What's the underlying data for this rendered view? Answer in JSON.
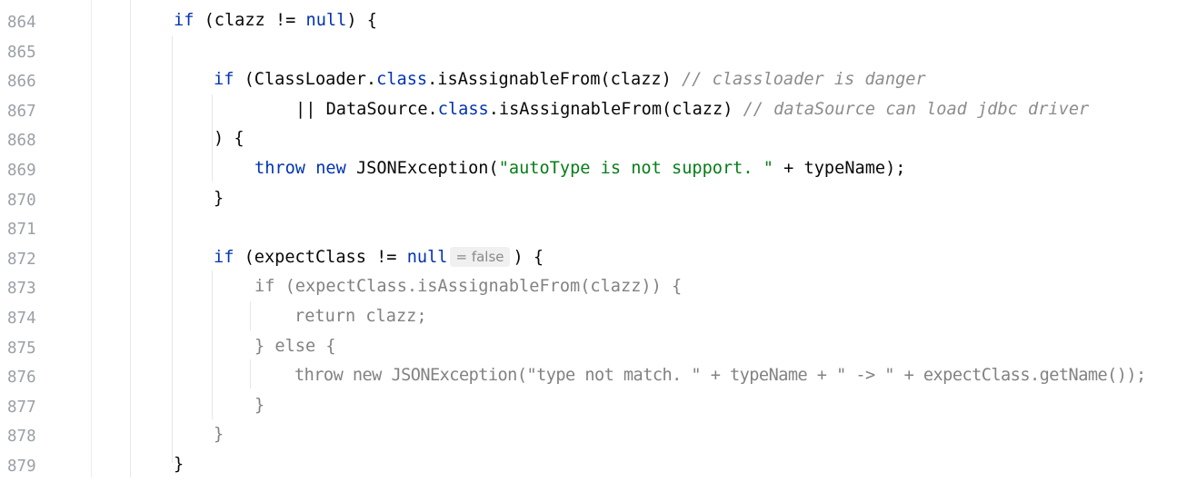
{
  "gutter": {
    "line_numbers": [
      "864",
      "865",
      "866",
      "867",
      "868",
      "869",
      "870",
      "871",
      "872",
      "873",
      "874",
      "875",
      "876",
      "877",
      "878",
      "879"
    ]
  },
  "code": {
    "l864": {
      "kw_if": "if",
      "t1": " (clazz != ",
      "kw_null": "null",
      "t2": ") {"
    },
    "l866": {
      "kw_if": "if",
      "t1": " (ClassLoader.",
      "kw_class": "class",
      "t2": ".isAssignableFrom(clazz) ",
      "comment": "// classloader is danger"
    },
    "l867": {
      "t1": "|| DataSource.",
      "kw_class": "class",
      "t2": ".isAssignableFrom(clazz) ",
      "comment": "// dataSource can load jdbc driver"
    },
    "l868": {
      "t1": ") {"
    },
    "l869": {
      "kw_throw": "throw",
      "sp": " ",
      "kw_new": "new",
      "t1": " JSONException(",
      "str": "\"autoType is not support. \"",
      "t2": " + typeName);"
    },
    "l870": {
      "t1": "}"
    },
    "l872": {
      "kw_if": "if",
      "t1": " (expectClass != ",
      "kw_null": "null",
      "hint": "= false",
      "t2": ") {"
    },
    "l873": {
      "t1": "if (expectClass.isAssignableFrom(clazz)) {"
    },
    "l874": {
      "t1": "return clazz;"
    },
    "l875": {
      "t1": "} else {"
    },
    "l876": {
      "t1": "throw new JSONException(\"type not match. \" + typeName + \" -> \" + expectClass.getName());"
    },
    "l877": {
      "t1": "}"
    },
    "l878": {
      "t1": "}"
    },
    "l879": {
      "t1": "}"
    }
  },
  "colors": {
    "keyword": "#0033b3",
    "comment": "#8c8c8c",
    "string": "#067d17",
    "dimmed_code": "#828282",
    "line_number": "#9aa0a6",
    "inlay_hint_bg": "#f0f0f0"
  }
}
